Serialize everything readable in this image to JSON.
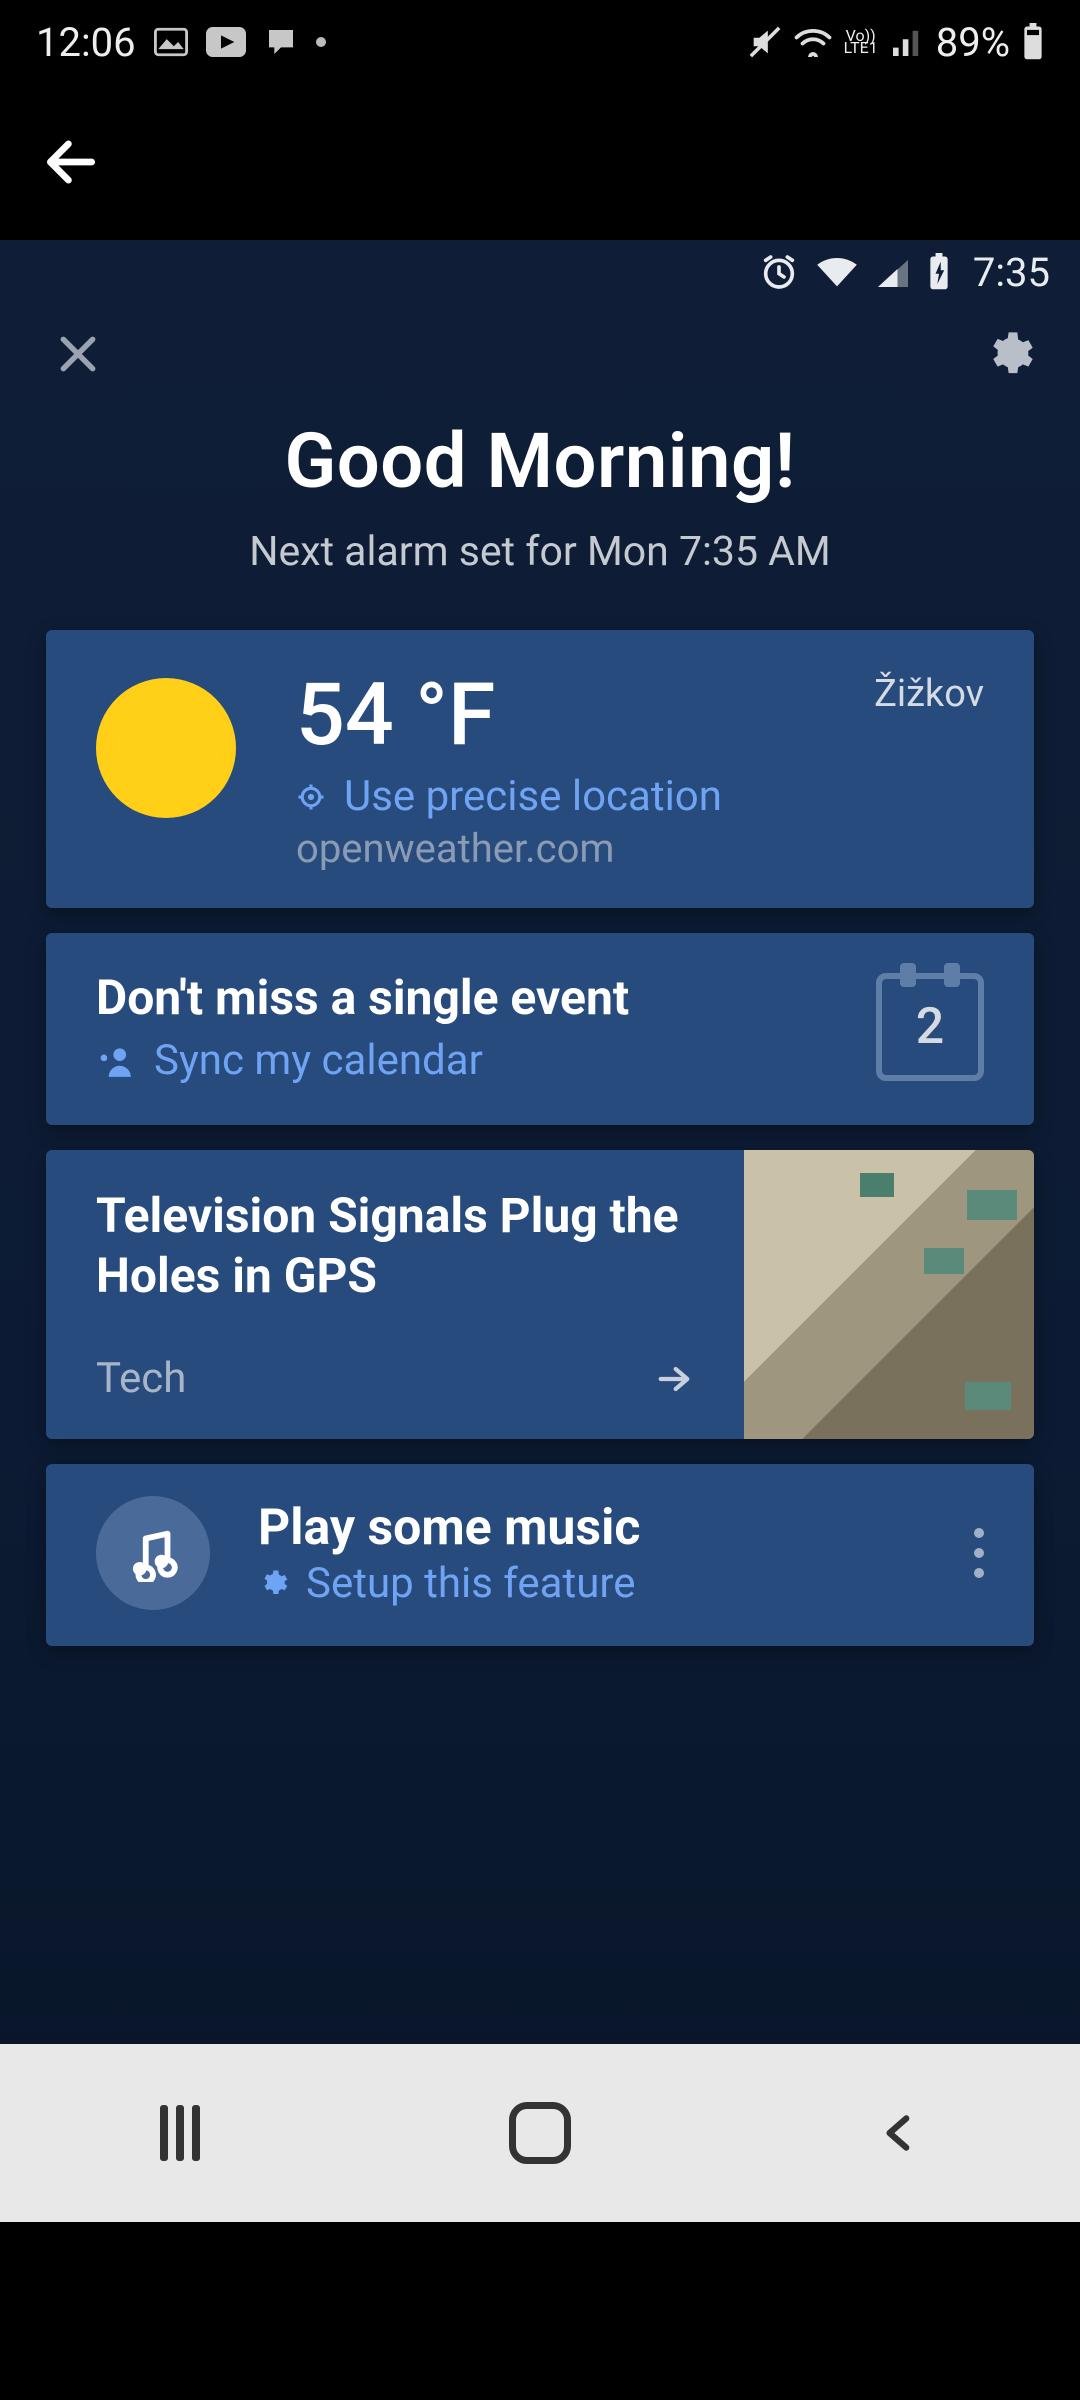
{
  "outer_status": {
    "time": "12:06",
    "battery_pct": "89%"
  },
  "inner_status": {
    "time": "7:35"
  },
  "greeting": {
    "title": "Good Morning!",
    "subtitle": "Next alarm set for Mon 7:35 AM"
  },
  "weather": {
    "temperature": "54 °F",
    "precise_label": "Use precise location",
    "source": "openweather.com",
    "location": "Žižkov"
  },
  "calendar": {
    "title": "Don't miss a single event",
    "link_label": "Sync my calendar",
    "day_number": "2"
  },
  "news": {
    "title": "Television Signals Plug the Holes in GPS",
    "category": "Tech"
  },
  "music": {
    "title": "Play some music",
    "link_label": "Setup this feature"
  }
}
